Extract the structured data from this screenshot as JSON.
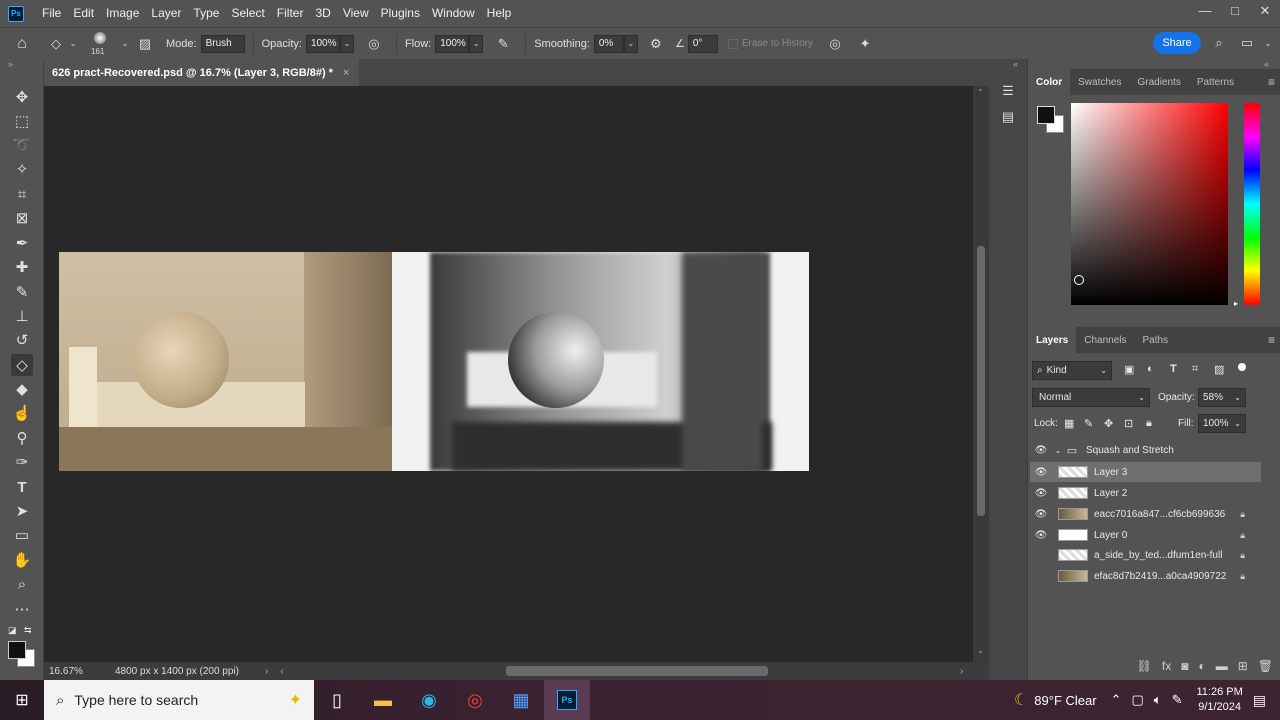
{
  "menubar": {
    "logo": "Ps",
    "items": [
      "File",
      "Edit",
      "Image",
      "Layer",
      "Type",
      "Select",
      "Filter",
      "3D",
      "View",
      "Plugins",
      "Window",
      "Help"
    ],
    "window_controls": [
      "—",
      "□",
      "✕"
    ]
  },
  "options": {
    "brush_size": "161",
    "mode_label": "Mode:",
    "mode_value": "Brush",
    "opacity_label": "Opacity:",
    "opacity_value": "100%",
    "flow_label": "Flow:",
    "flow_value": "100%",
    "smoothing_label": "Smoothing:",
    "smoothing_value": "0%",
    "angle_value": "0°",
    "erase_history_label": "Erase to History",
    "share_label": "Share"
  },
  "document": {
    "tab_title": "626 pract-Recovered.psd @ 16.7% (Layer 3, RGB/8#) *",
    "tab_close": "×",
    "zoom": "16.67%",
    "dimensions": "4800 px x 1400 px (200 ppi)"
  },
  "color_panel": {
    "tabs": [
      "Color",
      "Swatches",
      "Gradients",
      "Patterns"
    ],
    "active_tab": "Color"
  },
  "layers_panel": {
    "tabs": [
      "Layers",
      "Channels",
      "Paths"
    ],
    "kind_label": "Kind",
    "blend_mode": "Normal",
    "opacity_label": "Opacity:",
    "opacity_value": "58%",
    "lock_label": "Lock:",
    "fill_label": "Fill:",
    "fill_value": "100%",
    "group_name": "Squash and Stretch",
    "layers": [
      {
        "name": "Layer 3",
        "visible": true,
        "locked": false,
        "selected": true
      },
      {
        "name": "Layer 2",
        "visible": true,
        "locked": false,
        "selected": false
      },
      {
        "name": "eacc7016a847...cf6cb699636",
        "visible": true,
        "locked": true,
        "selected": false
      },
      {
        "name": "Layer 0",
        "visible": true,
        "locked": true,
        "selected": false
      },
      {
        "name": "a_side_by_ted...dfum1en-full",
        "visible": false,
        "locked": true,
        "selected": false
      },
      {
        "name": "efac8d7b2419...a0ca4909722",
        "visible": false,
        "locked": true,
        "selected": false
      }
    ]
  },
  "taskbar": {
    "search_placeholder": "Type here to search",
    "weather": "89°F  Clear",
    "time": "11:26 PM",
    "date": "9/1/2024"
  }
}
